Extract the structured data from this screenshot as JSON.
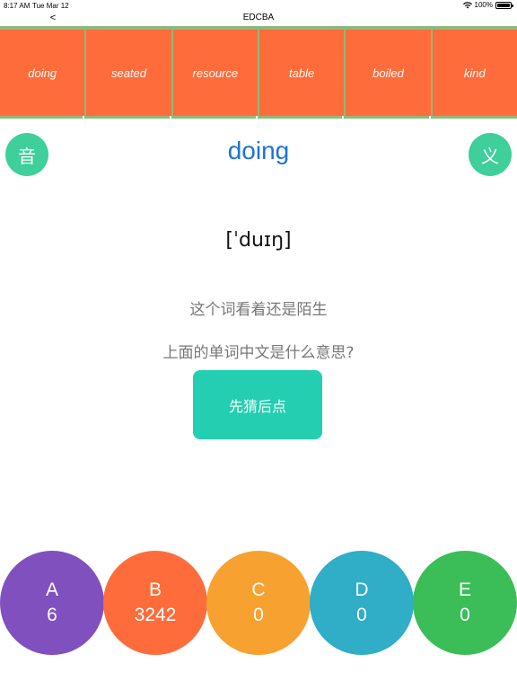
{
  "status_bar": {
    "time": "8:17 AM",
    "date": "Tue Mar 12",
    "battery": "100%"
  },
  "nav": {
    "back_label": "<",
    "title": "EDCBA"
  },
  "word_strip": [
    {
      "word": "doing"
    },
    {
      "word": "seated"
    },
    {
      "word": "resource"
    },
    {
      "word": "table"
    },
    {
      "word": "boiled"
    },
    {
      "word": "kind"
    }
  ],
  "main": {
    "sound_label": "音",
    "meaning_label": "义",
    "word": "doing",
    "phonetic": "[ˈduɪŋ]",
    "hint_familiar": "这个词看着还是陌生",
    "hint_question": "上面的单词中文是什么意思?",
    "guess_button": "先猜后点"
  },
  "scores": [
    {
      "letter": "A",
      "count": "6",
      "color": "#8150bf"
    },
    {
      "letter": "B",
      "count": "3242",
      "color": "#fe6c3b"
    },
    {
      "letter": "C",
      "count": "0",
      "color": "#f7a230"
    },
    {
      "letter": "D",
      "count": "0",
      "color": "#30adc7"
    },
    {
      "letter": "E",
      "count": "0",
      "color": "#3bbe58"
    }
  ],
  "colors": {
    "tile": "#fe6c3b",
    "strip_border": "#8fb97a",
    "round_button": "#3ecf9b",
    "word": "#1a73d9",
    "guess_button": "#23cfb0"
  },
  "icons": {
    "wifi": "wifi-icon",
    "battery": "battery-icon",
    "back": "chevron-left-icon"
  }
}
